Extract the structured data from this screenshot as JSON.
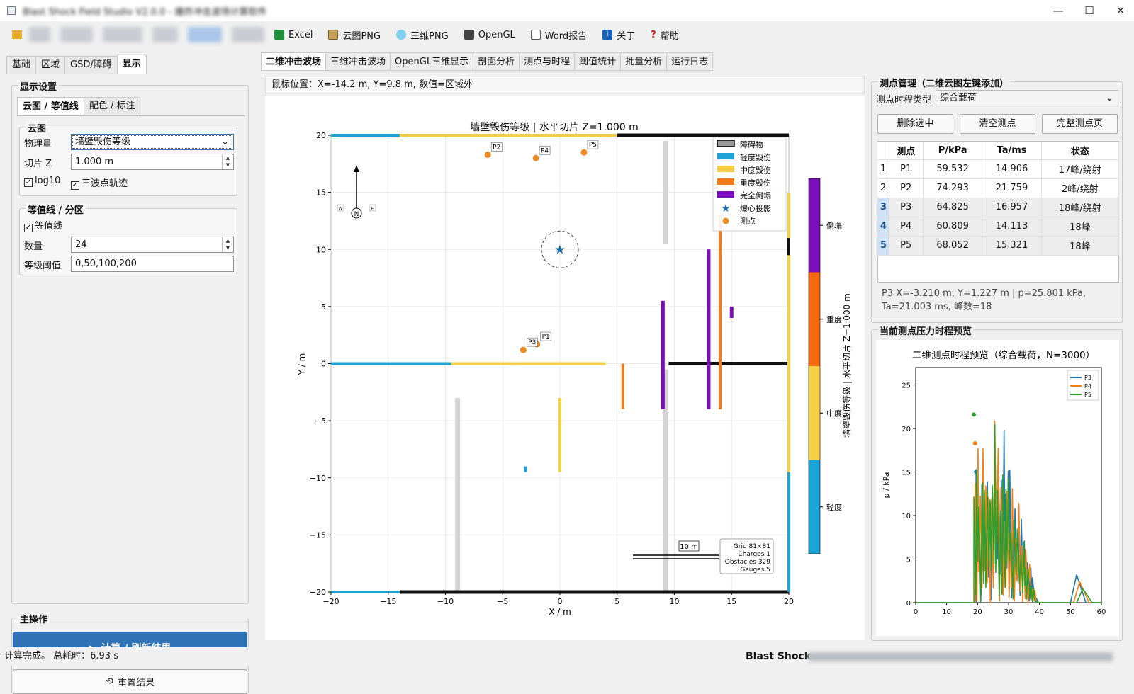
{
  "window": {
    "title": "Blast Shock Field Studio V2.0.0 - 爆炸冲击波场计算软件"
  },
  "toolbar": {
    "items": [
      {
        "label": "Excel",
        "icon": "excel-icon",
        "color": "#1f8f3a"
      },
      {
        "label": "云图PNG",
        "icon": "image-icon",
        "color": "#b07a2f"
      },
      {
        "label": "三维PNG",
        "icon": "globe-icon",
        "color": "#2a9ac8"
      },
      {
        "label": "OpenGL",
        "icon": "monitor-icon",
        "color": "#333333"
      },
      {
        "label": "Word报告",
        "icon": "document-icon",
        "color": "#555555"
      },
      {
        "label": "关于",
        "icon": "info-icon",
        "color": "#1a62b8"
      },
      {
        "label": "帮助",
        "icon": "help-icon",
        "color": "#cc2222"
      }
    ]
  },
  "left": {
    "tabs": [
      "基础",
      "区域",
      "GSD/障碍",
      "显示"
    ],
    "display_group": "显示设置",
    "sub_tabs": [
      "云图 / 等值线",
      "配色 / 标注"
    ],
    "cloud_group": "云图",
    "quantity_label": "物理量",
    "quantity_value": "墙壁毁伤等级",
    "slice_label": "切片 Z",
    "slice_value": "1.000 m",
    "log10_label": "log10",
    "trajectory_label": "三波点轨迹",
    "contour_group": "等值线 / 分区",
    "contour_label": "等值线",
    "count_label": "数量",
    "count_value": "24",
    "threshold_label": "等级阈值",
    "threshold_value": "0,50,100,200",
    "main_ops": "主操作",
    "compute_button": "计算 / 刷新结果",
    "reset_button": "重置结果"
  },
  "main": {
    "tabs": [
      "二维冲击波场",
      "三维冲击波场",
      "OpenGL三维显示",
      "剖面分析",
      "测点与时程",
      "阈值统计",
      "批量分析",
      "运行日志"
    ],
    "mouse_status": "鼠标位置：X=-14.2 m, Y=9.8 m, 数值=区域外"
  },
  "chart_data": [
    {
      "type": "heatmap",
      "title": "墙壁毁伤等级  |  水平切片 Z=1.000 m",
      "xlabel": "X / m",
      "ylabel": "Y / m",
      "xlim": [
        -20,
        20
      ],
      "ylim": [
        -20,
        20
      ],
      "xticks": [
        "-20",
        "-15",
        "-10",
        "-5",
        "0",
        "5",
        "10",
        "15",
        "20"
      ],
      "yticks": [
        "20",
        "15",
        "10",
        "5",
        "0",
        "-5",
        "-10",
        "-15",
        "-20"
      ],
      "legend": [
        {
          "label": "障碍物",
          "color": "#9a9a9a"
        },
        {
          "label": "轻度毁伤",
          "color": "#1ca3d8"
        },
        {
          "label": "中度毁伤",
          "color": "#f5cf46"
        },
        {
          "label": "重度毁伤",
          "color": "#f07a1e"
        },
        {
          "label": "完全倒塌",
          "color": "#7a0fb8"
        },
        {
          "label": "爆心投影",
          "color": "#1f6aa8"
        },
        {
          "label": "测点",
          "color": "#f08a24"
        }
      ],
      "charge": {
        "x": 0,
        "y": 10
      },
      "gauges": [
        {
          "name": "P1",
          "x": -2,
          "y": 1.7
        },
        {
          "name": "P2",
          "x": -6.3,
          "y": 18.3
        },
        {
          "name": "P3",
          "x": -3.2,
          "y": 1.2
        },
        {
          "name": "P4",
          "x": -2.1,
          "y": 18
        },
        {
          "name": "P5",
          "x": 2.1,
          "y": 18.5
        }
      ],
      "colorbar": {
        "label": "墙壁毁伤等级  |  水平切片 Z=1.000 m",
        "levels": [
          "轻度",
          "中度",
          "重度",
          "倒塌"
        ],
        "colors": [
          "#1ca3d8",
          "#f5cf46",
          "#f56a10",
          "#7a0fb8"
        ]
      },
      "compass": {
        "north": "N",
        "west": "W",
        "east": "E"
      },
      "scale_label": "10 m",
      "info": [
        "Grid 81×81",
        "Charges 1",
        "Obstacles 329",
        "Gauges 5"
      ]
    },
    {
      "type": "line",
      "title": "二维测点时程预览（综合载荷，N=3000）",
      "xlabel": "",
      "ylabel": "p / kPa",
      "xlim": [
        0,
        60
      ],
      "ylim": [
        0,
        27
      ],
      "xticks": [
        "0",
        "10",
        "20",
        "30",
        "40",
        "50",
        "60"
      ],
      "yticks": [
        "0",
        "5",
        "10",
        "15",
        "20",
        "25"
      ],
      "series": [
        {
          "name": "P3",
          "color": "#1f77b4"
        },
        {
          "name": "P4",
          "color": "#ff7f0e"
        },
        {
          "name": "P5",
          "color": "#2ca02c"
        }
      ]
    }
  ],
  "right": {
    "group_title": "测点管理（二维云图左键添加）",
    "type_label": "测点时程类型",
    "type_value": "综合载荷",
    "buttons": [
      "删除选中",
      "清空测点",
      "完整测点页"
    ],
    "headers": [
      "测点",
      "P/kPa",
      "Ta/ms",
      "状态"
    ],
    "rows": [
      {
        "n": "1",
        "name": "P1",
        "p": "59.532",
        "ta": "14.906",
        "status": "17峰/绕射"
      },
      {
        "n": "2",
        "name": "P2",
        "p": "74.293",
        "ta": "21.759",
        "status": "2峰/绕射"
      },
      {
        "n": "3",
        "name": "P3",
        "p": "64.825",
        "ta": "16.957",
        "status": "18峰/绕射"
      },
      {
        "n": "4",
        "name": "P4",
        "p": "60.809",
        "ta": "14.113",
        "status": "18峰"
      },
      {
        "n": "5",
        "name": "P5",
        "p": "68.052",
        "ta": "15.321",
        "status": "18峰"
      }
    ],
    "detail_line1": "P3  X=-3.210 m, Y=1.227 m  |  p=25.801 kPa,",
    "detail_line2": "Ta=21.003 ms, 峰数=18",
    "preview_title": "当前测点压力时程预览"
  },
  "status": {
    "left": "计算完成。 总耗时：6.93 s",
    "right": "Blast Shock"
  }
}
